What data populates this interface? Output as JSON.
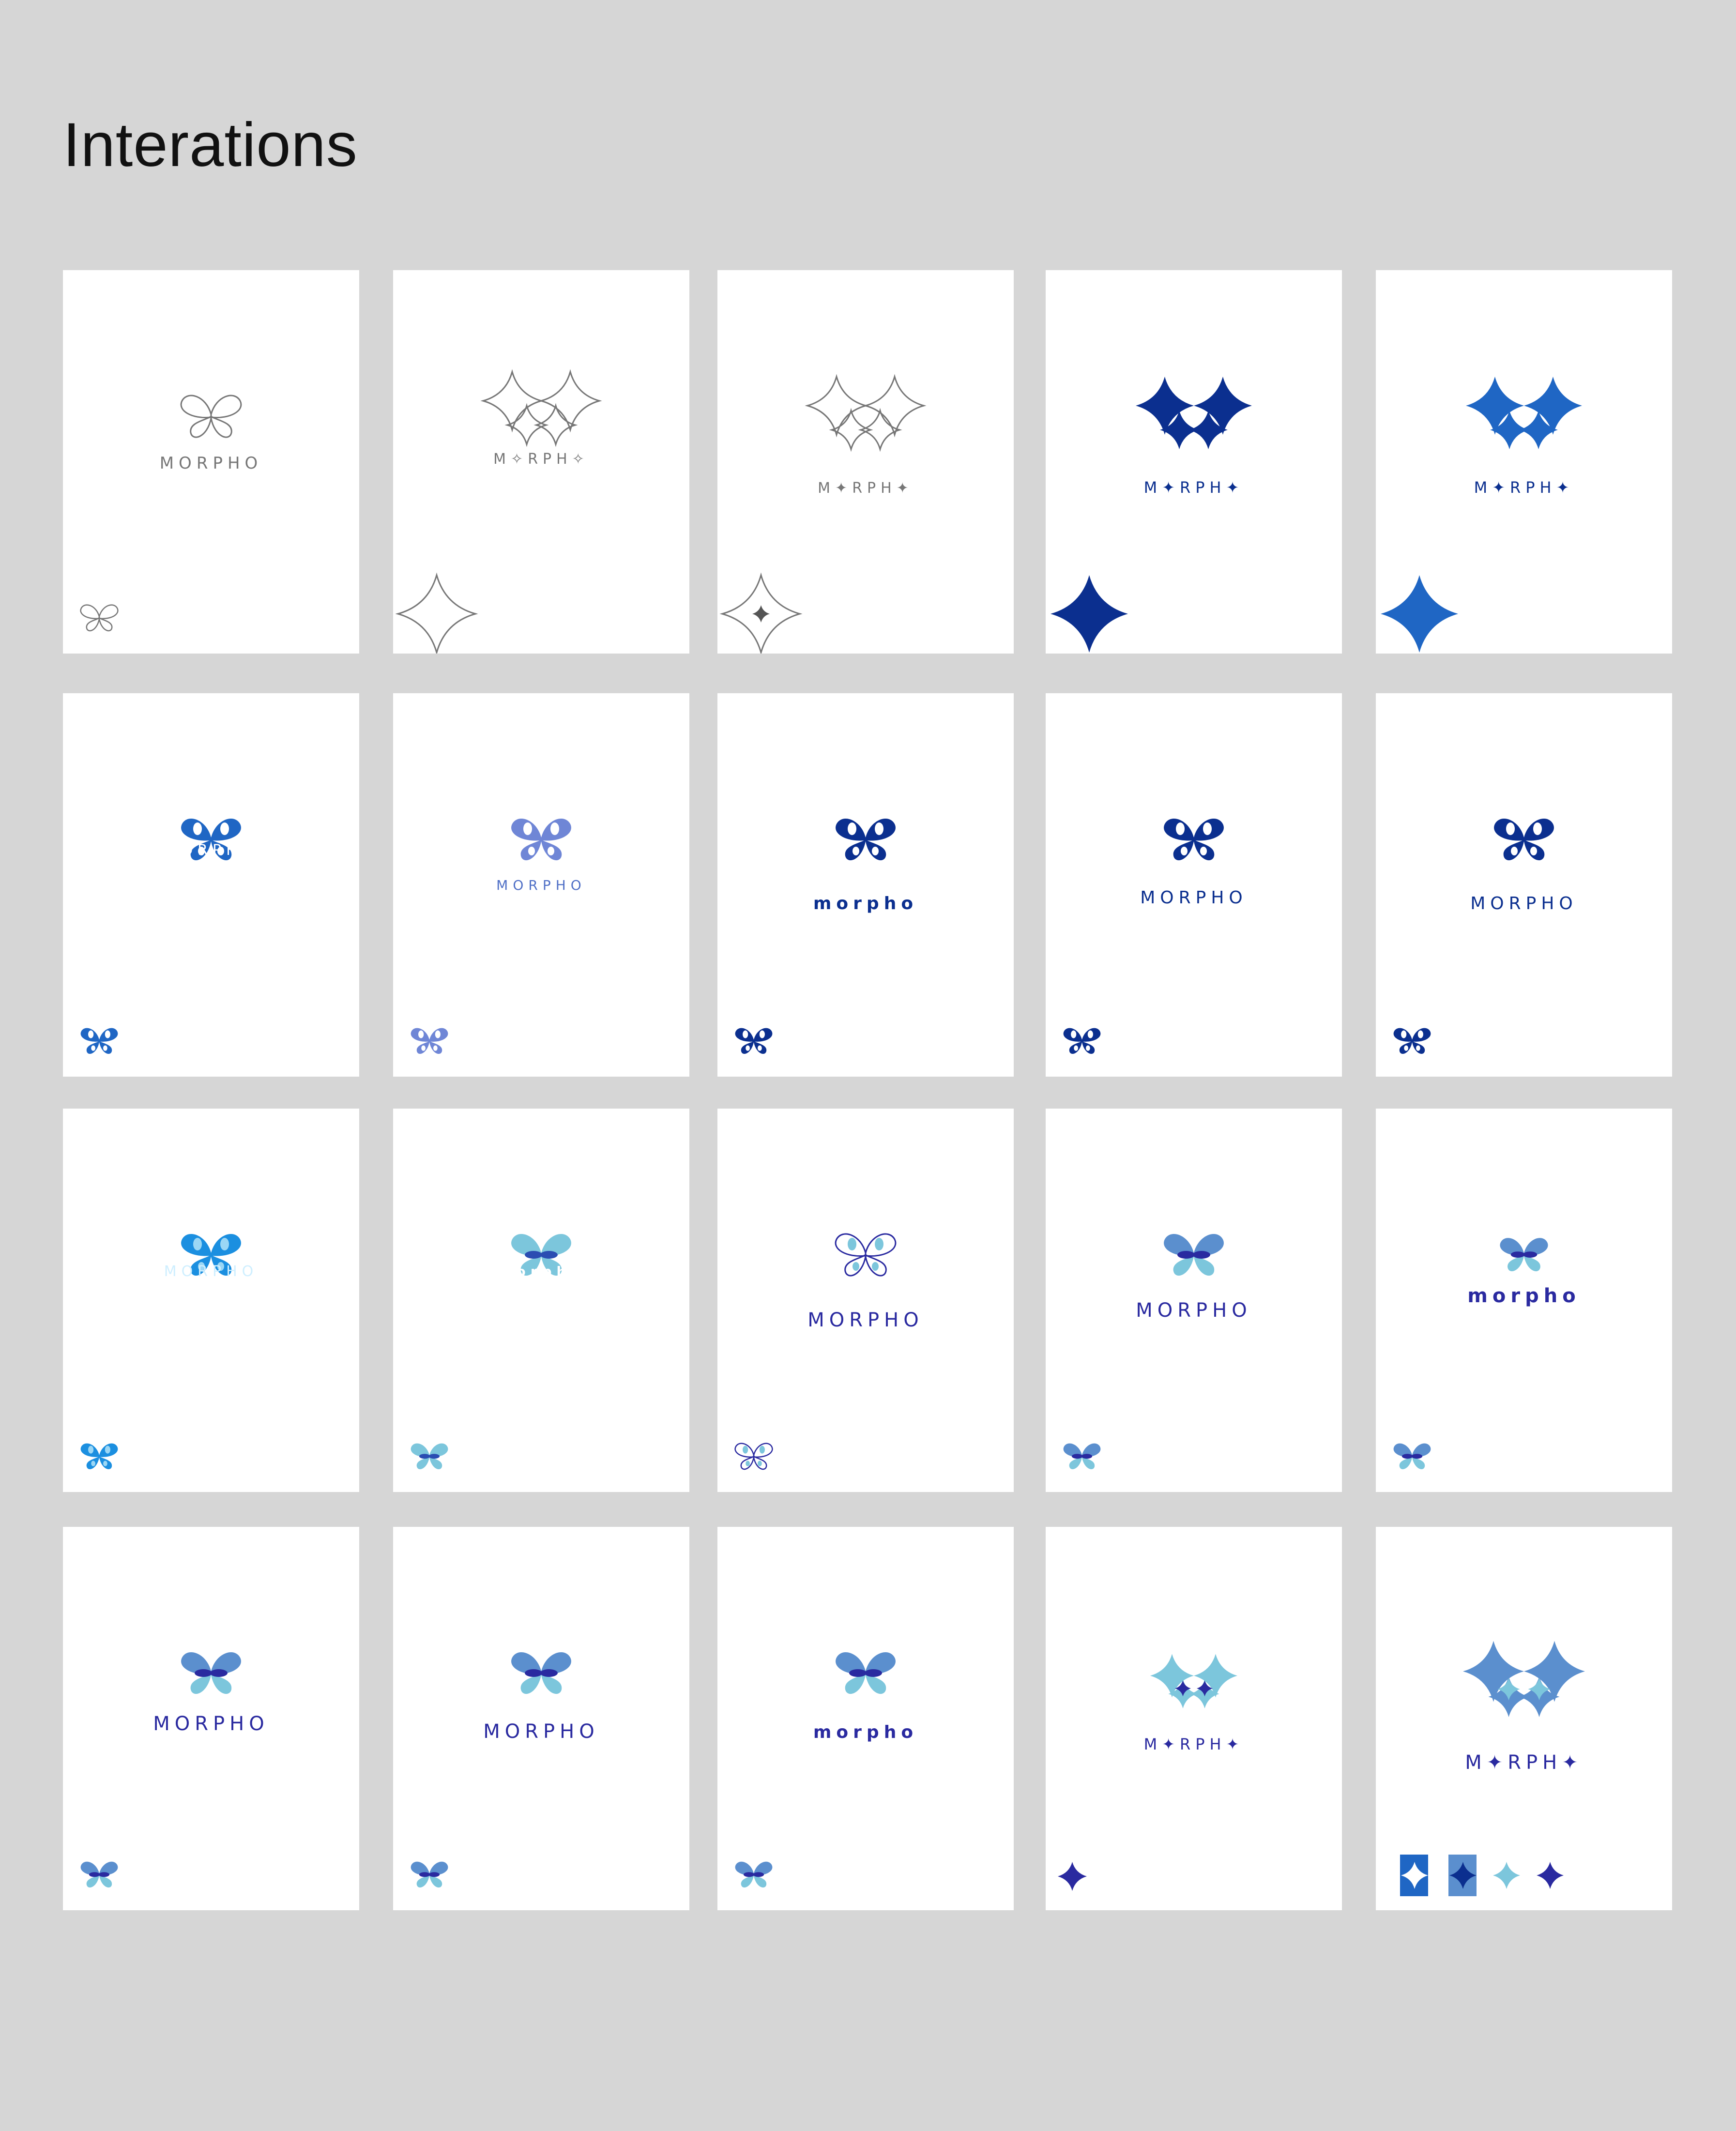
{
  "title": "Interations",
  "colors": {
    "background": "#d6d6d6",
    "card": "#ffffff",
    "outline_gray": "#777777",
    "navy": "#0b2f8f",
    "royal": "#1f66c4",
    "bright": "#1b8fe0",
    "sky": "#7cc6dc",
    "steel": "#5b8fce",
    "indigo": "#2a2aa0"
  },
  "cards": [
    {
      "wordmark": "MORPHO",
      "icon": "butterfly-outline-icon"
    },
    {
      "wordmark": "M✧RPH✧",
      "icon": "star-butterfly-outline-icon"
    },
    {
      "wordmark": "M✦RPH✦",
      "icon": "star-butterfly-outline-icon"
    },
    {
      "wordmark": "M✦RPH✦",
      "icon": "star-butterfly-navy-icon"
    },
    {
      "wordmark": "M✦RPH✦",
      "icon": "star-butterfly-blue-icon"
    },
    {
      "wordmark": "MORPHO",
      "icon": "butterfly-blue-icon"
    },
    {
      "wordmark": "MORPHO",
      "icon": "butterfly-gradient-icon"
    },
    {
      "wordmark": "morpho",
      "icon": "butterfly-navy-icon"
    },
    {
      "wordmark": "MORPHO",
      "icon": "butterfly-navy-icon"
    },
    {
      "wordmark": "MORPHO",
      "icon": "butterfly-navy-icon"
    },
    {
      "wordmark": "MORPHO",
      "icon": "butterfly-bright-icon"
    },
    {
      "wordmark": "morpho",
      "icon": "butterfly-layered-icon"
    },
    {
      "wordmark": "MORPHO",
      "icon": "butterfly-outline-blue-icon"
    },
    {
      "wordmark": "MORPHO",
      "icon": "butterfly-layered-icon"
    },
    {
      "wordmark": "morpho",
      "icon": "butterfly-layered-icon"
    },
    {
      "wordmark": "MORPHO",
      "icon": "butterfly-layered-icon"
    },
    {
      "wordmark": "MORPHO",
      "icon": "butterfly-layered-icon"
    },
    {
      "wordmark": "morpho",
      "icon": "butterfly-layered-icon"
    },
    {
      "wordmark": "M✦RPH✦",
      "icon": "star-cluster-icon"
    },
    {
      "wordmark": "M✦RPH✦",
      "icon": "star-cluster-icon"
    }
  ]
}
